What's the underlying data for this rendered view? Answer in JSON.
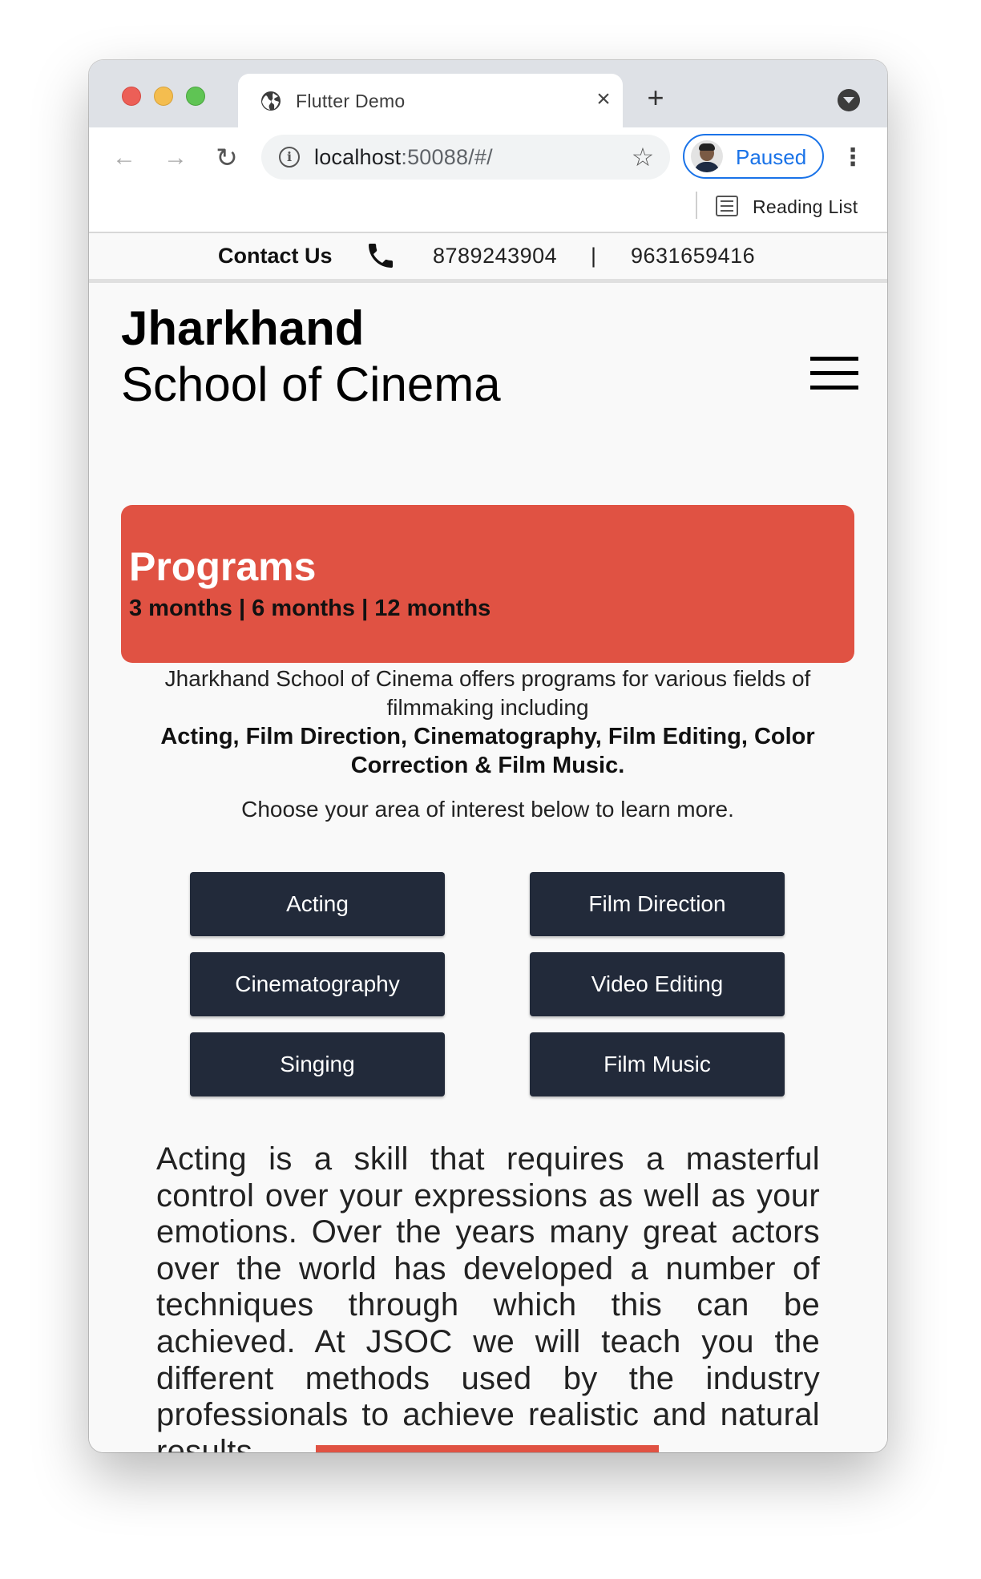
{
  "browser": {
    "tab_title": "Flutter Demo",
    "new_tab_label": "+",
    "url_host": "localhost",
    "url_rest": ":50088/#/",
    "profile_label": "Paused",
    "bookmarks": {
      "reading_list": "Reading List"
    }
  },
  "contact": {
    "label": "Contact Us",
    "phone1": "8789243904",
    "separator": "|",
    "phone2": "9631659416"
  },
  "header": {
    "brand_line1": "Jharkhand",
    "brand_line2": "School of Cinema"
  },
  "programs": {
    "title": "Programs",
    "durations": "3 months | 6 months | 12 months",
    "intro": "Jharkhand School of Cinema offers programs for various fields of filmmaking including",
    "fields": "Acting, Film Direction, Cinematography, Film Editing, Color Correction & Film Music.",
    "choose": "Choose your area of interest below to learn more."
  },
  "areas": [
    {
      "label": "Acting"
    },
    {
      "label": "Film Direction"
    },
    {
      "label": "Cinematography"
    },
    {
      "label": "Video Editing"
    },
    {
      "label": "Singing"
    },
    {
      "label": "Film Music"
    }
  ],
  "description": "Acting is a skill that requires a masterful control over your expressions as well as your emotions. Over the years many great actors over the world has developed a number of techniques through which this can be achieved. At JSOC we will teach you the different methods used by the industry professionals to achieve realistic and natural results.",
  "colors": {
    "accent": "#e05243",
    "button_bg": "#222a3a",
    "link_blue": "#1a73e8"
  }
}
